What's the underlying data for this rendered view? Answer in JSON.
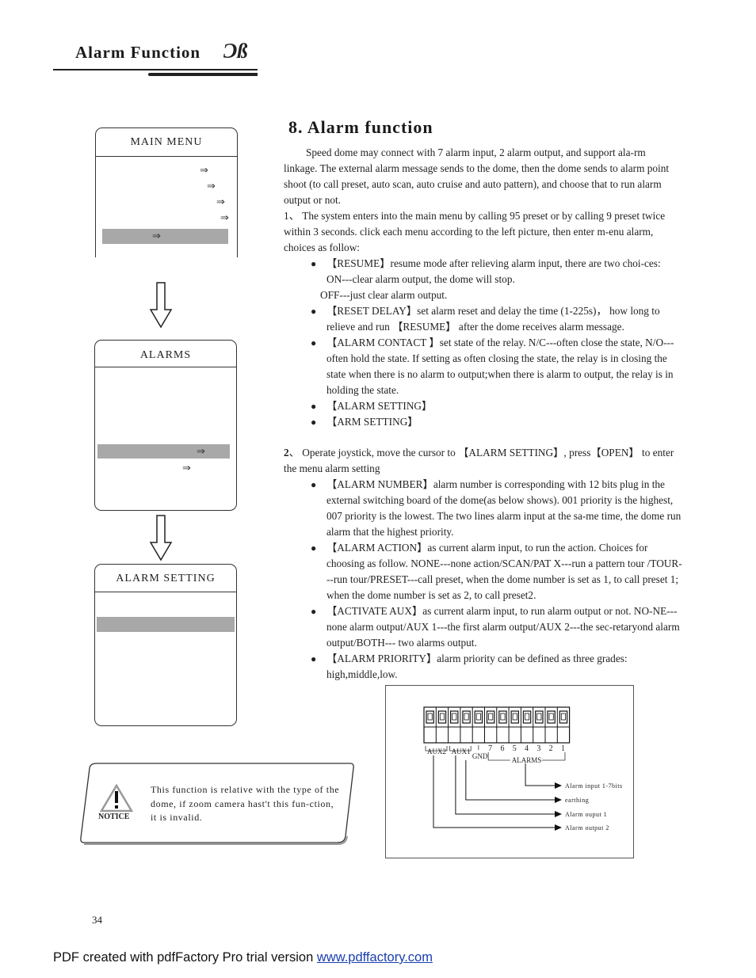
{
  "header": {
    "title": "Alarm Function",
    "logo_glyph": "Ɔß"
  },
  "menus": {
    "main_menu": {
      "title": "MAIN   MENU",
      "arrow_glyph": "⇒",
      "highlighted_index": 4,
      "item_count": 5
    },
    "alarms": {
      "title": "ALARMS",
      "arrow_glyph": "⇒",
      "highlighted_index": 0
    },
    "alarm_setting": {
      "title": "ALARM   SETTING"
    }
  },
  "notice": {
    "label": "NOTICE",
    "icon": "warning-triangle-icon",
    "text": "This function is relative with the type of the dome, if zoom camera hast't this fun-ction, it is invalid."
  },
  "section": {
    "title": "8.  Alarm function",
    "intro": "Speed dome may connect  with 7 alarm input, 2 alarm output, and support ala-rm linkage. The external alarm message sends to the dome, then the dome sends to alarm point shoot (to call preset, auto scan, auto cruise and auto pattern), and choose that to run alarm output or not.",
    "step1": "1、 The system enters into the main menu by calling 95 preset or by calling  9 preset twice within 3 seconds.  click each menu according to the left picture, then enter m-enu alarm, choices as follow:",
    "step1_bullets": [
      {
        "text": "【RESUME】resume mode after relieving alarm input, there are two choi-ces: ON---clear alarm output, the dome will stop.",
        "extra": "OFF---just clear alarm output."
      },
      {
        "text": "【RESET   DELAY】set alarm reset and delay the time (1-225s)， how long to relieve and run 【RESUME】 after the dome receives alarm message."
      },
      {
        "text": "【ALARM   CONTACT 】set state of the relay. N/C---often close the state, N/O---often hold the state. If setting as often closing the state, the relay is in closing the state when there is no alarm to output;when there is alarm to output, the relay is in holding the state."
      },
      {
        "text": "【ALARM   SETTING】"
      },
      {
        "text": "【ARM  SETTING】"
      }
    ],
    "step2_num": "2",
    "step2": "、 Operate joystick, move the cursor  to 【ALARM SETTING】, press【OPEN】 to enter the menu alarm setting",
    "step2_bullets": [
      {
        "text": "【ALARM  NUMBER】alarm number is corresponding with 12 bits plug in the external switching board of the dome(as below shows). 001 priority is the highest, 007 priority  is the lowest. The two lines alarm input at the sa-me time, the dome run alarm that the highest priority."
      },
      {
        "text": "【ALARM  ACTION】as current  alarm input, to run the action. Choices for choosing as follow. NONE---none action/SCAN/PAT X---run a pattern tour /TOUR---run tour/PRESET---call preset, when the dome number is set as 1, to call preset 1; when the dome number is set as 2, to call preset2."
      },
      {
        "text": "【ACTIVATE  AUX】as current alarm input, to run alarm output or not. NO-NE---none alarm output/AUX 1---the first alarm output/AUX 2---the sec-retaryond alarm output/BOTH--- two alarms output."
      },
      {
        "text": "【ALARM  PRIORITY】alarm priority can be defined  as  three grades: high,middle,low."
      }
    ]
  },
  "diagram": {
    "pin_count": 12,
    "group_labels": {
      "aux2": "AUX2",
      "aux1": "AUX1",
      "gnd": "GND",
      "alarms": "ALARMS"
    },
    "alarm_numbers": [
      "7",
      "6",
      "5",
      "4",
      "3",
      "2",
      "1"
    ],
    "callouts": [
      "Alarm input 1-7bits",
      "earthing",
      "Alarm ouput 1",
      "Alarm output 2"
    ]
  },
  "page_number": "34",
  "footer": {
    "text": "PDF created with pdfFactory Pro trial version ",
    "link": "www.pdffactory.com"
  }
}
